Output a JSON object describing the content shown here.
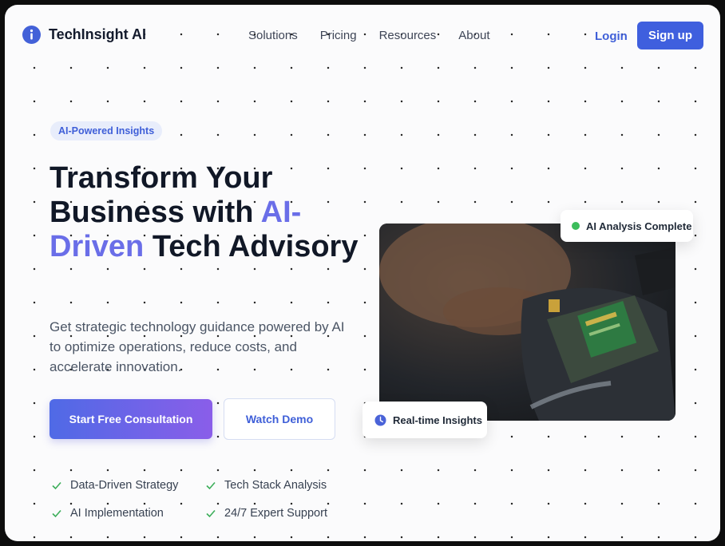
{
  "brand": {
    "name": "TechInsight AI",
    "icon": "info-icon",
    "accent": "#4361d8"
  },
  "nav": {
    "links": [
      "Solutions",
      "Pricing",
      "Resources",
      "About"
    ],
    "login": "Login",
    "signup": "Sign up"
  },
  "hero": {
    "badge": "AI-Powered Insights",
    "title_part1": "Transform Your Business with ",
    "title_highlight": "AI-Driven",
    "title_part2": " Tech Advisory",
    "subtitle": "Get strategic technology guidance powered by AI to optimize operations, reduce costs, and accelerate innovation.",
    "cta_primary": "Start Free Consultation",
    "cta_secondary": "Watch Demo",
    "features": [
      "Data-Driven Strategy",
      "Tech Stack Analysis",
      "AI Implementation",
      "24/7 Expert Support"
    ]
  },
  "visual": {
    "status_card": "AI Analysis Complete",
    "insights_card": "Real-time Insights",
    "status_color": "#3cbd5b"
  }
}
